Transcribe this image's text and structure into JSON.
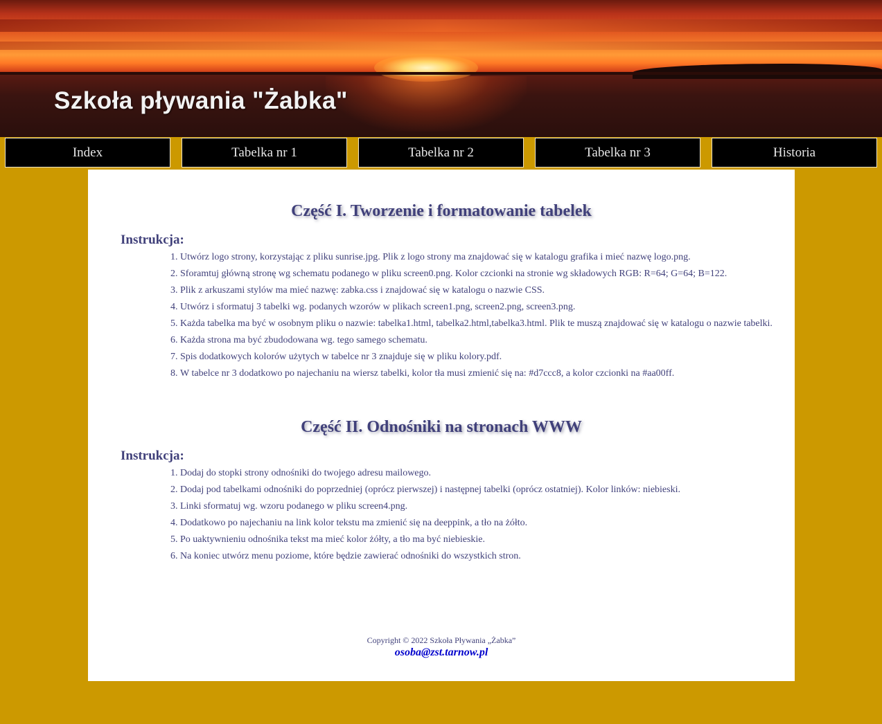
{
  "header": {
    "logo_text": "Szkoła pływania \"Żabka\""
  },
  "menu": {
    "items": [
      {
        "label": "Index"
      },
      {
        "label": "Tabelka nr 1"
      },
      {
        "label": "Tabelka nr 2"
      },
      {
        "label": "Tabelka nr 3"
      },
      {
        "label": "Historia"
      }
    ]
  },
  "sections": [
    {
      "title": "Część I. Tworzenie i formatowanie tabelek",
      "subtitle": "Instrukcja:",
      "items": [
        "Utwórz logo strony, korzystając z pliku sunrise.jpg. Plik z logo strony ma znajdować się w katalogu grafika i mieć nazwę logo.png.",
        "Sforamtuj główną stronę wg schematu podanego w pliku screen0.png. Kolor czcionki na stronie wg składowych RGB: R=64; G=64; B=122.",
        "Plik z arkuszami stylów ma mieć nazwę: zabka.css i znajdować się w katalogu o nazwie CSS.",
        "Utwórz i sformatuj 3 tabelki wg. podanych wzorów w plikach screen1.png, screen2.png, screen3.png.",
        "Każda tabelka ma być w osobnym pliku o nazwie: tabelka1.html, tabelka2.html,tabelka3.html. Plik te muszą znajdować się w katalogu o nazwie tabelki.",
        "Każda strona ma być zbudodowana wg. tego samego schematu.",
        "Spis dodatkowych kolorów użytych w tabelce nr 3 znajduje się w pliku kolory.pdf.",
        "W tabelce nr 3 dodatkowo po najechaniu na wiersz tabelki, kolor tła musi zmienić się na: #d7ccc8, a kolor czcionki na #aa00ff."
      ]
    },
    {
      "title": "Część II. Odnośniki na stronach WWW",
      "subtitle": "Instrukcja:",
      "items": [
        "Dodaj do stopki strony odnośniki do twojego adresu mailowego.",
        "Dodaj pod tabelkami odnośniki do poprzedniej (oprócz pierwszej) i następnej tabelki (oprócz ostatniej). Kolor linków: niebieski.",
        "Linki sformatuj wg. wzoru podanego w pliku screen4.png.",
        "Dodatkowo po najechaniu na link kolor tekstu ma zmienić się na deeppink, a tło na żółto.",
        "Po uaktywnieniu odnośnika tekst ma mieć kolor żółty, a tło ma być niebieskie.",
        "Na koniec utwórz menu poziome, które będzie zawierać odnośniki do wszystkich stron."
      ]
    }
  ],
  "footer": {
    "copyright": "Copyright © 2022 Szkoła Pływania „Żabka”",
    "email": "osoba@zst.tarnow.pl"
  },
  "colors": {
    "page_background": "#cc9900",
    "text": "#40407a",
    "menu_background": "#000000",
    "menu_text": "#e8e8e8",
    "email_link": "#0000cc"
  }
}
